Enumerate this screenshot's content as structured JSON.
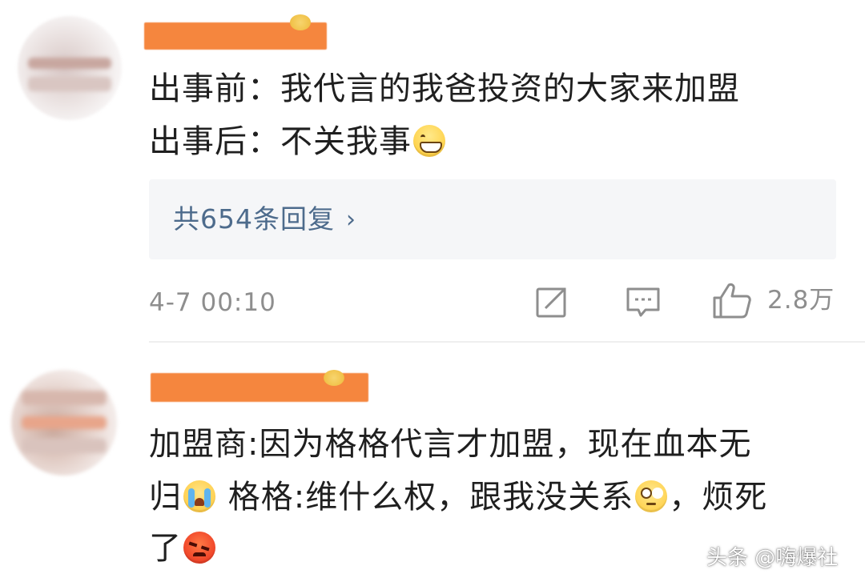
{
  "comments": [
    {
      "lines": [
        "出事前：我代言的我爸投资的大家来加盟",
        "出事后：不关我事"
      ],
      "line2_emoji": "grin-emoji",
      "replies_label": "共654条回复",
      "replies_chevron": "›",
      "timestamp": "4-7 00:10",
      "share_icon": "share-icon",
      "comment_icon": "comment-icon",
      "like_icon": "thumbs-up-icon",
      "like_count": "2.8万"
    },
    {
      "line1": "加盟商:因为格格代言才加盟，现在血本无",
      "line2_part1": "归",
      "line2_emoji1": "crying-emoji",
      "line2_part2": " 格格:维什么权，跟我没关系",
      "line2_emoji2": "eye-roll-emoji",
      "line2_part3": "，烦死",
      "line3_part1": "了",
      "line3_emoji": "angry-emoji"
    }
  ],
  "watermark": "头条 @嗨爆社",
  "colors": {
    "link": "#4d6b8c",
    "meta": "#8e8e8e",
    "name_mask": "#f5863e",
    "reply_bg": "#f5f6f8"
  }
}
